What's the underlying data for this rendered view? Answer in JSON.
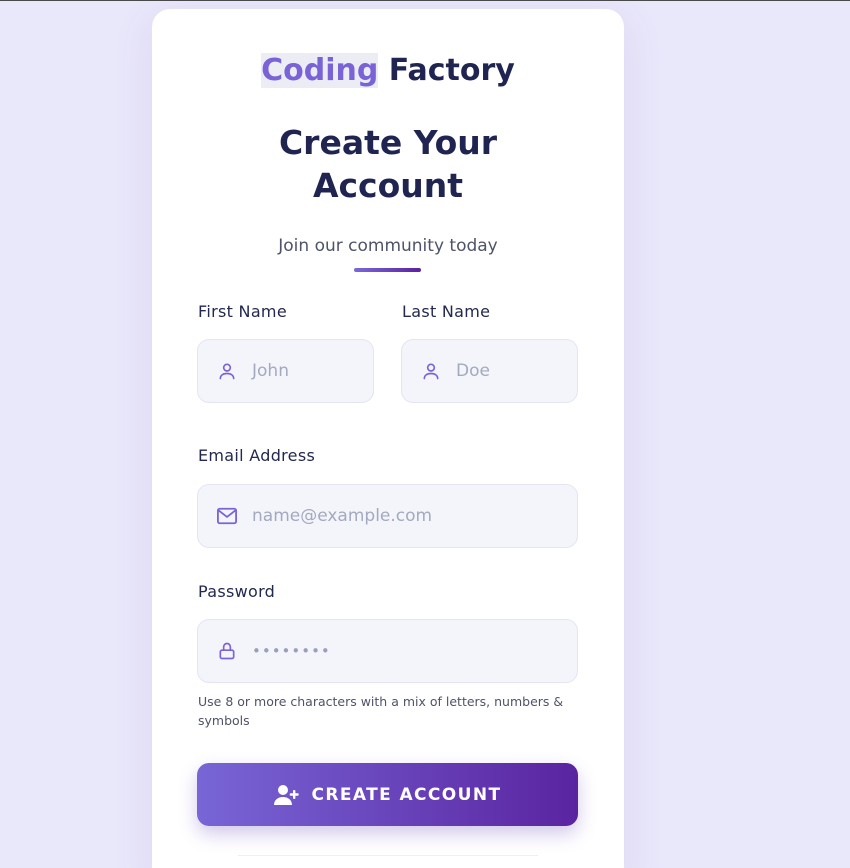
{
  "brand": {
    "part1": "Coding",
    "part2": " Factory"
  },
  "heading": "Create Your Account",
  "subtitle": "Join our community today",
  "form": {
    "first_name": {
      "label": "First Name",
      "placeholder": "John",
      "icon": "user-icon"
    },
    "last_name": {
      "label": "Last Name",
      "placeholder": "Doe",
      "icon": "user-icon"
    },
    "email": {
      "label": "Email Address",
      "placeholder": "name@example.com",
      "icon": "mail-icon"
    },
    "password": {
      "label": "Password",
      "placeholder": "••••••••",
      "icon": "lock-icon",
      "hint": "Use 8 or more characters with a mix of letters, numbers & symbols"
    },
    "submit": {
      "label": "CREATE ACCOUNT",
      "icon": "user-plus-icon"
    }
  },
  "colors": {
    "accent": "#7a63d6",
    "navy": "#1f2450",
    "gradient_start": "#7866d6",
    "gradient_end": "#5a24a0",
    "background": "#e9e7fa"
  }
}
